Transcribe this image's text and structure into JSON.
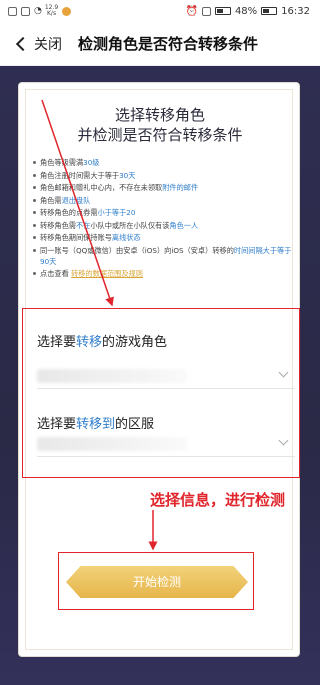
{
  "status_bar": {
    "speed_top": "12.9",
    "speed_bottom": "K/s",
    "battery": "48%",
    "time": "16:32"
  },
  "nav": {
    "back_label": "关闭",
    "title": "检测角色是否符合转移条件"
  },
  "card": {
    "title_line1": "选择转移角色",
    "title_line2": "并检测是否符合转移条件",
    "rules": [
      {
        "parts": [
          {
            "t": "角色等级需满"
          },
          {
            "t": "30级",
            "hl": true
          }
        ]
      },
      {
        "parts": [
          {
            "t": "角色注册时间需大于等于"
          },
          {
            "t": "30天",
            "hl": true
          }
        ]
      },
      {
        "parts": [
          {
            "t": "角色邮箱和赠礼中心内，不存在未领取"
          },
          {
            "t": "附件的邮件",
            "hl": true
          }
        ]
      },
      {
        "parts": [
          {
            "t": "角色需"
          },
          {
            "t": "退出盘队",
            "hl": true
          }
        ]
      },
      {
        "parts": [
          {
            "t": "转移角色的点券需"
          },
          {
            "t": "小于等于20",
            "hl": true
          }
        ]
      },
      {
        "parts": [
          {
            "t": "转移角色需"
          },
          {
            "t": "不在",
            "hl": true
          },
          {
            "t": "小队中或所在小队仅有该"
          },
          {
            "t": "角色一人",
            "hl": true
          }
        ]
      },
      {
        "parts": [
          {
            "t": "转移角色期间保持账号"
          },
          {
            "t": "离线状态",
            "hl": true
          }
        ]
      },
      {
        "parts": [
          {
            "t": "同一账号（QQ或微信）由安卓（iOS）向iOS（安卓）转移的"
          },
          {
            "t": "时间间隔大于等于90天",
            "hl": true
          }
        ]
      },
      {
        "parts": [
          {
            "t": "点击查看 "
          },
          {
            "t": "转移的数据范围及规则",
            "link": true
          }
        ]
      }
    ]
  },
  "select": {
    "role_label_pre": "选择要",
    "role_label_hl": "转移",
    "role_label_post": "的游戏角色",
    "server_label_pre": "选择要",
    "server_label_hl": "转移到",
    "server_label_post": "的区服"
  },
  "annotation": {
    "text": "选择信息，进行检测",
    "color": "#e0252c"
  },
  "start_button": {
    "label": "开始检测",
    "color": "#e6b54a"
  },
  "icons": [
    "back-chevron-icon",
    "dropdown-chevron-icon",
    "battery-icon",
    "wifi-icon",
    "alarm-icon"
  ]
}
